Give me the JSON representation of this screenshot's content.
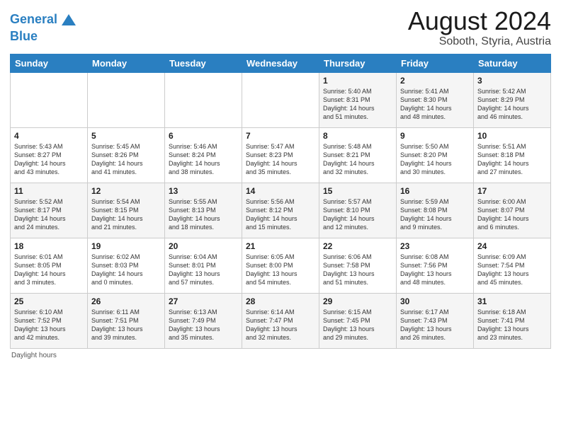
{
  "header": {
    "logo_line1": "General",
    "logo_line2": "Blue",
    "month_year": "August 2024",
    "location": "Soboth, Styria, Austria"
  },
  "days_of_week": [
    "Sunday",
    "Monday",
    "Tuesday",
    "Wednesday",
    "Thursday",
    "Friday",
    "Saturday"
  ],
  "footer": {
    "daylight_label": "Daylight hours"
  },
  "weeks": [
    [
      {
        "day": "",
        "info": ""
      },
      {
        "day": "",
        "info": ""
      },
      {
        "day": "",
        "info": ""
      },
      {
        "day": "",
        "info": ""
      },
      {
        "day": "1",
        "info": "Sunrise: 5:40 AM\nSunset: 8:31 PM\nDaylight: 14 hours\nand 51 minutes."
      },
      {
        "day": "2",
        "info": "Sunrise: 5:41 AM\nSunset: 8:30 PM\nDaylight: 14 hours\nand 48 minutes."
      },
      {
        "day": "3",
        "info": "Sunrise: 5:42 AM\nSunset: 8:29 PM\nDaylight: 14 hours\nand 46 minutes."
      }
    ],
    [
      {
        "day": "4",
        "info": "Sunrise: 5:43 AM\nSunset: 8:27 PM\nDaylight: 14 hours\nand 43 minutes."
      },
      {
        "day": "5",
        "info": "Sunrise: 5:45 AM\nSunset: 8:26 PM\nDaylight: 14 hours\nand 41 minutes."
      },
      {
        "day": "6",
        "info": "Sunrise: 5:46 AM\nSunset: 8:24 PM\nDaylight: 14 hours\nand 38 minutes."
      },
      {
        "day": "7",
        "info": "Sunrise: 5:47 AM\nSunset: 8:23 PM\nDaylight: 14 hours\nand 35 minutes."
      },
      {
        "day": "8",
        "info": "Sunrise: 5:48 AM\nSunset: 8:21 PM\nDaylight: 14 hours\nand 32 minutes."
      },
      {
        "day": "9",
        "info": "Sunrise: 5:50 AM\nSunset: 8:20 PM\nDaylight: 14 hours\nand 30 minutes."
      },
      {
        "day": "10",
        "info": "Sunrise: 5:51 AM\nSunset: 8:18 PM\nDaylight: 14 hours\nand 27 minutes."
      }
    ],
    [
      {
        "day": "11",
        "info": "Sunrise: 5:52 AM\nSunset: 8:17 PM\nDaylight: 14 hours\nand 24 minutes."
      },
      {
        "day": "12",
        "info": "Sunrise: 5:54 AM\nSunset: 8:15 PM\nDaylight: 14 hours\nand 21 minutes."
      },
      {
        "day": "13",
        "info": "Sunrise: 5:55 AM\nSunset: 8:13 PM\nDaylight: 14 hours\nand 18 minutes."
      },
      {
        "day": "14",
        "info": "Sunrise: 5:56 AM\nSunset: 8:12 PM\nDaylight: 14 hours\nand 15 minutes."
      },
      {
        "day": "15",
        "info": "Sunrise: 5:57 AM\nSunset: 8:10 PM\nDaylight: 14 hours\nand 12 minutes."
      },
      {
        "day": "16",
        "info": "Sunrise: 5:59 AM\nSunset: 8:08 PM\nDaylight: 14 hours\nand 9 minutes."
      },
      {
        "day": "17",
        "info": "Sunrise: 6:00 AM\nSunset: 8:07 PM\nDaylight: 14 hours\nand 6 minutes."
      }
    ],
    [
      {
        "day": "18",
        "info": "Sunrise: 6:01 AM\nSunset: 8:05 PM\nDaylight: 14 hours\nand 3 minutes."
      },
      {
        "day": "19",
        "info": "Sunrise: 6:02 AM\nSunset: 8:03 PM\nDaylight: 14 hours\nand 0 minutes."
      },
      {
        "day": "20",
        "info": "Sunrise: 6:04 AM\nSunset: 8:01 PM\nDaylight: 13 hours\nand 57 minutes."
      },
      {
        "day": "21",
        "info": "Sunrise: 6:05 AM\nSunset: 8:00 PM\nDaylight: 13 hours\nand 54 minutes."
      },
      {
        "day": "22",
        "info": "Sunrise: 6:06 AM\nSunset: 7:58 PM\nDaylight: 13 hours\nand 51 minutes."
      },
      {
        "day": "23",
        "info": "Sunrise: 6:08 AM\nSunset: 7:56 PM\nDaylight: 13 hours\nand 48 minutes."
      },
      {
        "day": "24",
        "info": "Sunrise: 6:09 AM\nSunset: 7:54 PM\nDaylight: 13 hours\nand 45 minutes."
      }
    ],
    [
      {
        "day": "25",
        "info": "Sunrise: 6:10 AM\nSunset: 7:52 PM\nDaylight: 13 hours\nand 42 minutes."
      },
      {
        "day": "26",
        "info": "Sunrise: 6:11 AM\nSunset: 7:51 PM\nDaylight: 13 hours\nand 39 minutes."
      },
      {
        "day": "27",
        "info": "Sunrise: 6:13 AM\nSunset: 7:49 PM\nDaylight: 13 hours\nand 35 minutes."
      },
      {
        "day": "28",
        "info": "Sunrise: 6:14 AM\nSunset: 7:47 PM\nDaylight: 13 hours\nand 32 minutes."
      },
      {
        "day": "29",
        "info": "Sunrise: 6:15 AM\nSunset: 7:45 PM\nDaylight: 13 hours\nand 29 minutes."
      },
      {
        "day": "30",
        "info": "Sunrise: 6:17 AM\nSunset: 7:43 PM\nDaylight: 13 hours\nand 26 minutes."
      },
      {
        "day": "31",
        "info": "Sunrise: 6:18 AM\nSunset: 7:41 PM\nDaylight: 13 hours\nand 23 minutes."
      }
    ]
  ]
}
